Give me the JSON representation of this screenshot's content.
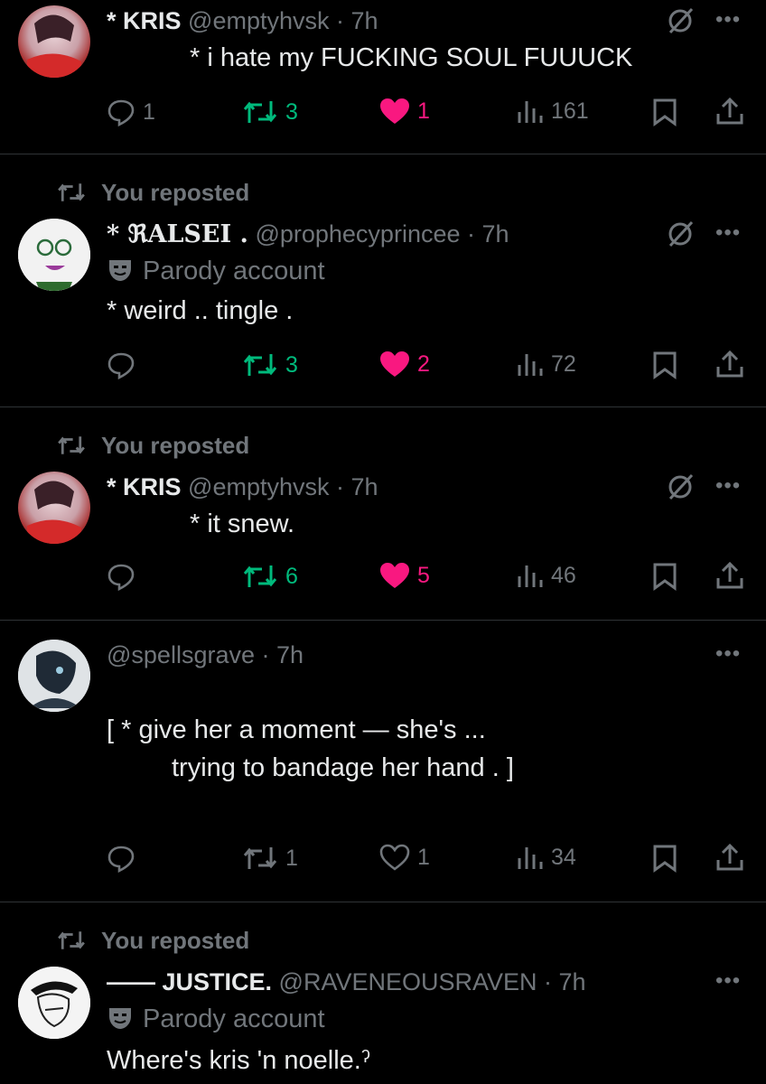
{
  "posts": [
    {
      "reposted": "",
      "name": "* KRIS",
      "handle": "@emptyhvsk",
      "time": "7h",
      "parody": "",
      "text_lines": [
        "*  i  hate  my  FUCKING  SOUL  FUUUCK"
      ],
      "replies": "1",
      "reposts": "3",
      "likes": "1",
      "views": "161",
      "liked": true,
      "retweeted": true
    },
    {
      "reposted": "You reposted",
      "name": "* ℜALSEI .",
      "handle": "@prophecyprincee",
      "time": "7h",
      "parody": "Parody account",
      "text_lines": [
        "*  weird .. tingle ."
      ],
      "replies": "",
      "reposts": "3",
      "likes": "2",
      "views": "72",
      "liked": true,
      "retweeted": true
    },
    {
      "reposted": "You reposted",
      "name": "* KRIS",
      "handle": "@emptyhvsk",
      "time": "7h",
      "parody": "",
      "text_lines": [
        "*  it  snew."
      ],
      "replies": "",
      "reposts": "6",
      "likes": "5",
      "views": "46",
      "liked": true,
      "retweeted": true
    },
    {
      "reposted": "",
      "name": "",
      "handle": "@spellsgrave",
      "time": "7h",
      "parody": "",
      "text_lines": [
        "[   *    give her a moment —    she's ...",
        "trying to bandage her hand .   ]"
      ],
      "replies": "",
      "reposts": "1",
      "likes": "1",
      "views": "34",
      "liked": false,
      "retweeted": false
    },
    {
      "reposted": "You reposted",
      "name": "—— JUSTICE.",
      "handle": "@RAVENEOUSRAVEN",
      "time": "7h",
      "parody": "Parody account",
      "text_lines": [
        "Where's  kris  'n  noelle.ˀ"
      ]
    }
  ],
  "icons": {
    "reply": "reply-icon",
    "repost": "repost-icon",
    "like": "heart-icon",
    "views": "views-icon",
    "bookmark": "bookmark-icon",
    "share": "share-icon",
    "grok": "grok-icon",
    "more": "more-icon",
    "parody": "mask-icon"
  },
  "colors": {
    "green": "#00ba7c",
    "pink": "#f91880",
    "gray": "#71767b",
    "text": "#e7e9ea"
  }
}
